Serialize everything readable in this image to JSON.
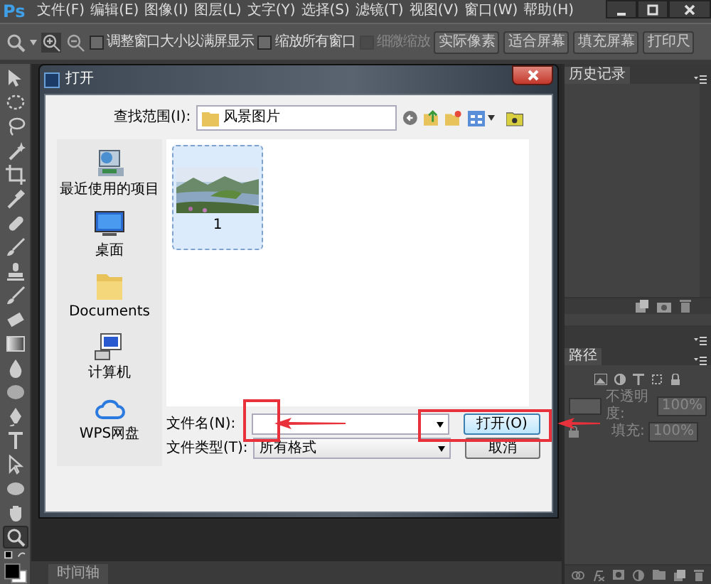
{
  "app": {
    "logo": "Ps"
  },
  "menu": [
    "文件(F)",
    "编辑(E)",
    "图像(I)",
    "图层(L)",
    "文字(Y)",
    "选择(S)",
    "滤镜(T)",
    "视图(V)",
    "窗口(W)",
    "帮助(H)"
  ],
  "options_bar": {
    "checkboxes": [
      {
        "label": "调整窗口大小以满屏显示",
        "checked": false,
        "disabled": false
      },
      {
        "label": "缩放所有窗口",
        "checked": false,
        "disabled": false
      },
      {
        "label": "细微缩放",
        "checked": false,
        "disabled": true
      }
    ],
    "buttons": [
      "实际像素",
      "适合屏幕",
      "填充屏幕",
      "打印尺"
    ]
  },
  "tools": [
    {
      "kind": "move",
      "selected": false
    },
    {
      "kind": "marquee",
      "selected": false
    },
    {
      "kind": "lasso",
      "selected": false
    },
    {
      "kind": "wand",
      "selected": false
    },
    {
      "kind": "crop",
      "selected": false
    },
    {
      "kind": "eyedropper",
      "selected": false
    },
    {
      "kind": "bandage",
      "selected": false
    },
    {
      "kind": "brush",
      "selected": false
    },
    {
      "kind": "stamp",
      "selected": false
    },
    {
      "kind": "brush",
      "selected": false
    },
    {
      "kind": "eraser",
      "selected": false
    },
    {
      "kind": "gradient",
      "selected": false
    },
    {
      "kind": "drop",
      "selected": false
    },
    {
      "kind": "sponge",
      "selected": false
    },
    {
      "kind": "pen",
      "selected": false
    },
    {
      "kind": "type",
      "selected": false
    },
    {
      "kind": "select",
      "selected": false
    },
    {
      "kind": "ellipse",
      "selected": false
    },
    {
      "kind": "hand",
      "selected": false
    },
    {
      "kind": "zoom",
      "selected": true
    }
  ],
  "dialog": {
    "title": "打开",
    "look_in": {
      "label": "查找范围(I):",
      "value": "风景图片"
    },
    "places": [
      {
        "label": "最近使用的项目",
        "kind": "recent"
      },
      {
        "label": "桌面",
        "kind": "desktop"
      },
      {
        "label": "Documents",
        "kind": "folder"
      },
      {
        "label": "计算机",
        "kind": "computer"
      },
      {
        "label": "WPS网盘",
        "kind": "cloud"
      }
    ],
    "files": [
      {
        "name": "1",
        "selected": true
      }
    ],
    "file_name": {
      "label": "文件名(N):"
    },
    "file_type": {
      "label": "文件类型(T):",
      "value": "所有格式"
    },
    "buttons": [
      {
        "label": "打开(O)",
        "default": true
      },
      {
        "label": "取消",
        "default": false
      }
    ]
  },
  "panels": {
    "history": {
      "tab": "历史记录"
    },
    "paths": {
      "tab": "路径"
    },
    "opacity": {
      "label": "不透明度:",
      "value": "100%",
      "disabled": true
    },
    "fill": {
      "label": "填充:",
      "value": "100%",
      "disabled": true
    }
  },
  "timeline": {
    "tab": "时间轴"
  }
}
